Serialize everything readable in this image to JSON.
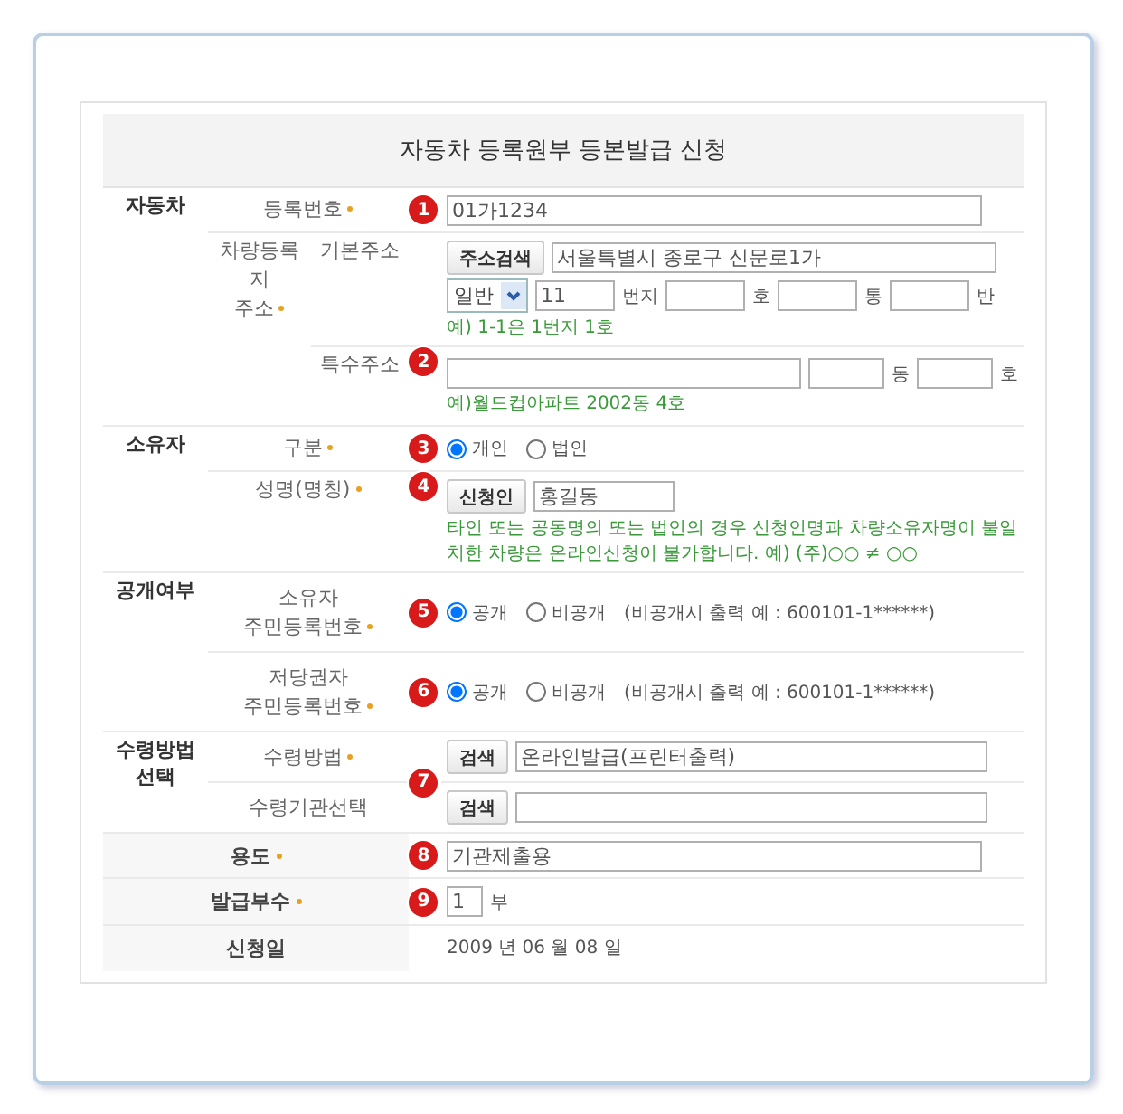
{
  "title": "자동차 등록원부 등본발급 신청",
  "sections": [
    {
      "group": [
        "자동차"
      ],
      "rows": [
        {
          "kind": "input",
          "label": [
            "등록번호"
          ],
          "required": true,
          "step": "1",
          "value": "01가1234"
        },
        {
          "kind": "basic_address",
          "label": [
            "차량등록지",
            "주소"
          ],
          "required": true,
          "sublabel": "기본주소",
          "button": "주소검색",
          "value": "서울특별시 종로구 신문로1가",
          "select": "일반",
          "fields": [
            {
              "value": "11",
              "unit": "번지"
            },
            {
              "unit": "호"
            },
            {
              "unit": "통"
            },
            {
              "unit": "반"
            }
          ],
          "hint": "예) 1-1은 1번지 1호"
        },
        {
          "kind": "special_address",
          "sublabel": "특수주소",
          "step": "2",
          "fields": [
            {
              "unit": "동"
            },
            {
              "unit": "호"
            }
          ],
          "hint": "예)월드컵아파트 2002동 4호"
        }
      ]
    },
    {
      "group": [
        "소유자"
      ],
      "rows": [
        {
          "kind": "radio",
          "label": [
            "구분"
          ],
          "required": true,
          "step": "3",
          "options": [
            {
              "label": "개인",
              "selected": true
            },
            {
              "label": "법인",
              "selected": false
            }
          ]
        },
        {
          "kind": "button_input",
          "label": [
            "성명(명칭)"
          ],
          "required": true,
          "step": "4",
          "button": "신청인",
          "value": "홍길동",
          "hint": "타인 또는 공동명의 또는 법인의 경우 신청인명과 차량소유자명이 불일치한 차량은 온라인신청이 불가합니다. 예) (주)○○ ≠ ○○"
        }
      ]
    },
    {
      "group": [
        "공개여부"
      ],
      "rows": [
        {
          "kind": "radio",
          "label": [
            "소유자",
            "주민등록번호"
          ],
          "required": true,
          "step": "5",
          "options": [
            {
              "label": "공개",
              "selected": true
            },
            {
              "label": "비공개",
              "selected": false
            }
          ],
          "note": "(비공개시 출력 예 : 600101-1******)"
        },
        {
          "kind": "radio",
          "label": [
            "저당권자",
            "주민등록번호"
          ],
          "required": true,
          "step": "6",
          "options": [
            {
              "label": "공개",
              "selected": true
            },
            {
              "label": "비공개",
              "selected": false
            }
          ],
          "note": "(비공개시 출력 예 : 600101-1******)"
        }
      ]
    },
    {
      "group": [
        "수령방법",
        "선택"
      ],
      "step": "7",
      "rows": [
        {
          "kind": "button_input",
          "label": [
            "수령방법"
          ],
          "required": true,
          "button": "검색",
          "value": "온라인발급(프린터출력)"
        },
        {
          "kind": "button_input",
          "label": [
            "수령기관선택"
          ],
          "required": false,
          "button": "검색"
        }
      ]
    },
    {
      "rows": [
        {
          "kind": "input",
          "label": [
            "용도"
          ],
          "required": true,
          "step": "8",
          "value": "기관제출용"
        }
      ]
    },
    {
      "rows": [
        {
          "kind": "count",
          "label": [
            "발급부수"
          ],
          "required": true,
          "step": "9",
          "value": "1",
          "unit": "부"
        }
      ]
    },
    {
      "rows": [
        {
          "kind": "text",
          "label": [
            "신청일"
          ],
          "required": false,
          "value": "2009 년 06 월 08 일"
        }
      ]
    }
  ]
}
